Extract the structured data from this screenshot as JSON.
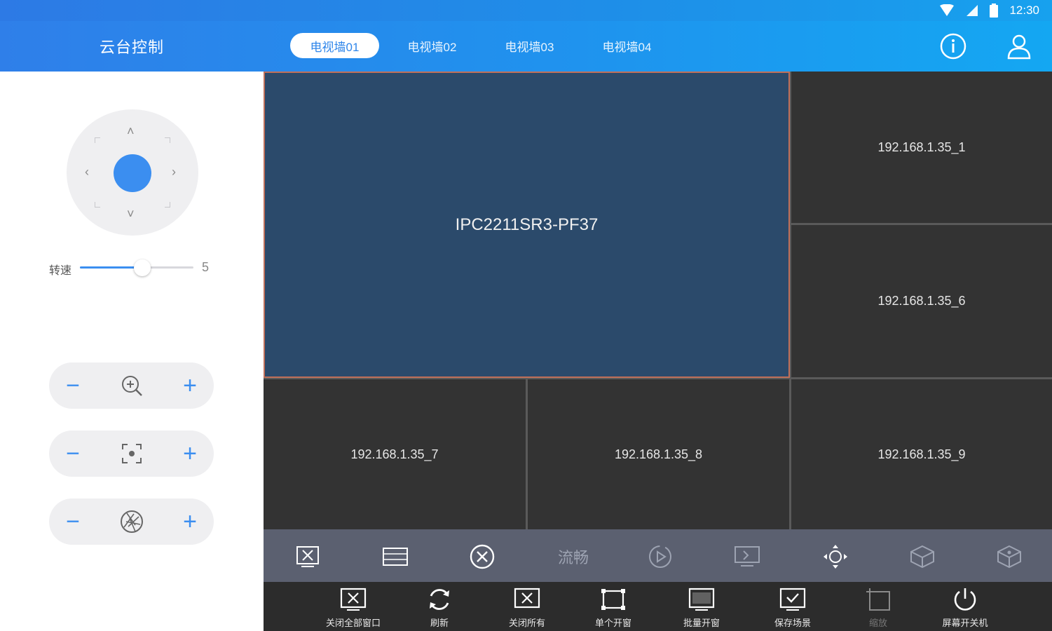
{
  "status_bar": {
    "time": "12:30"
  },
  "header": {
    "title": "云台控制",
    "tabs": [
      {
        "label": "电视墙01",
        "active": true
      },
      {
        "label": "电视墙02",
        "active": false
      },
      {
        "label": "电视墙03",
        "active": false
      },
      {
        "label": "电视墙04",
        "active": false
      }
    ],
    "icons": [
      "info-icon",
      "user-icon"
    ]
  },
  "ptz": {
    "joystick_arrows": {
      "up": "˄",
      "down": "˅",
      "left": "‹",
      "right": "›"
    },
    "speed": {
      "label": "转速",
      "value": "5",
      "level_fraction": 0.55
    },
    "controls": [
      {
        "name": "zoom",
        "icon": "zoom-in-icon"
      },
      {
        "name": "focus",
        "icon": "focus-icon"
      },
      {
        "name": "iris",
        "icon": "aperture-icon"
      }
    ],
    "minus": "−",
    "plus": "+"
  },
  "wall": {
    "cells": [
      {
        "id": "main",
        "label": "IPC2211SR3-PF37",
        "selected": true
      },
      {
        "id": "c1",
        "label": "192.168.1.35_1"
      },
      {
        "id": "c6",
        "label": "192.168.1.35_6"
      },
      {
        "id": "c7",
        "label": "192.168.1.35_7"
      },
      {
        "id": "c8",
        "label": "192.168.1.35_8"
      },
      {
        "id": "c9",
        "label": "192.168.1.35_9"
      }
    ]
  },
  "toolbar1": {
    "items": [
      "close-window-icon",
      "layout-icon",
      "close-circle-icon",
      "stream-quality-text",
      "playback-icon",
      "monitor-icon",
      "ptz-move-icon",
      "cube-icon",
      "cube-alt-icon"
    ],
    "stream_label": "流畅"
  },
  "toolbar2": {
    "items": [
      {
        "label": "关闭全部窗口",
        "icon": "close-all-windows-icon"
      },
      {
        "label": "刷新",
        "icon": "refresh-icon"
      },
      {
        "label": "关闭所有",
        "icon": "close-all-icon"
      },
      {
        "label": "单个开窗",
        "icon": "single-window-icon"
      },
      {
        "label": "批量开窗",
        "icon": "batch-window-icon"
      },
      {
        "label": "保存场景",
        "icon": "save-scene-icon"
      },
      {
        "label": "缩放",
        "icon": "resize-icon",
        "disabled": true
      },
      {
        "label": "屏幕开关机",
        "icon": "power-icon"
      }
    ]
  },
  "colors": {
    "accent": "#3b8ef0",
    "header_start": "#2f7fe9",
    "header_end": "#14a7f2",
    "wall_cell": "#333333",
    "main_cell": "#2b4a6b",
    "selected_border": "#c0705a",
    "toolbar1_bg": "#5b6070",
    "toolbar2_bg": "#2c2c2c"
  }
}
